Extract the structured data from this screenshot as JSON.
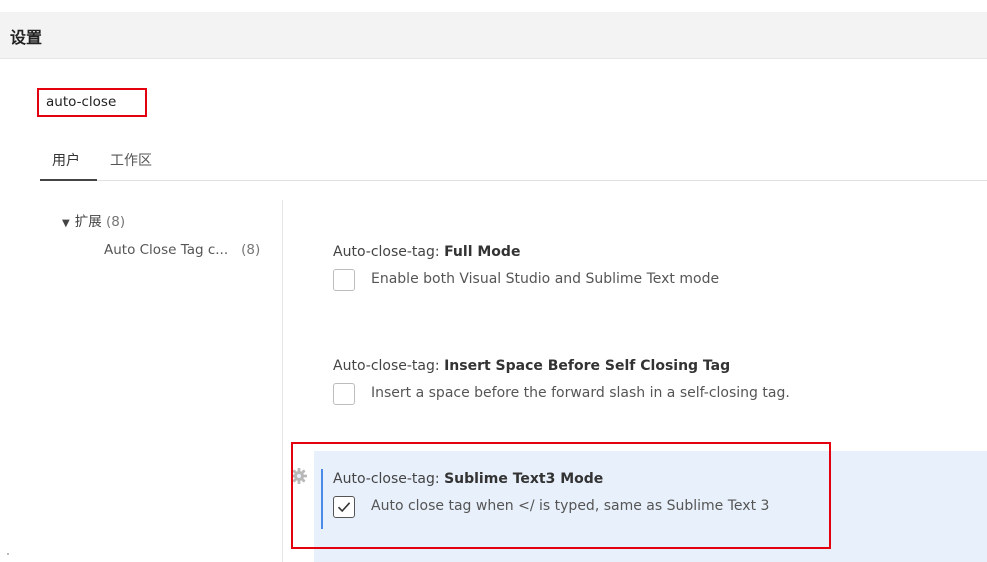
{
  "header": {
    "title": "设置"
  },
  "search": {
    "value": "auto-close"
  },
  "tabs": [
    {
      "label": "用户",
      "active": true
    },
    {
      "label": "工作区",
      "active": false
    }
  ],
  "tree": {
    "group_label": "扩展",
    "group_count": "(8)",
    "item_label": "Auto Close Tag c...",
    "item_count": "(8)"
  },
  "settings": [
    {
      "category": "Auto-close-tag: ",
      "name": "Full Mode",
      "description": "Enable both Visual Studio and Sublime Text mode",
      "checked": false
    },
    {
      "category": "Auto-close-tag: ",
      "name": "Insert Space Before Self Closing Tag",
      "description": "Insert a space before the forward slash in a self-closing tag.",
      "checked": false
    },
    {
      "category": "Auto-close-tag: ",
      "name": "Sublime Text3 Mode",
      "description": "Auto close tag when </ is typed, same as Sublime Text 3",
      "checked": true
    }
  ],
  "colors": {
    "highlight_box": "#e3000f",
    "focus_bar": "#4b8be8",
    "selected_row_bg": "#e8f0fb"
  }
}
